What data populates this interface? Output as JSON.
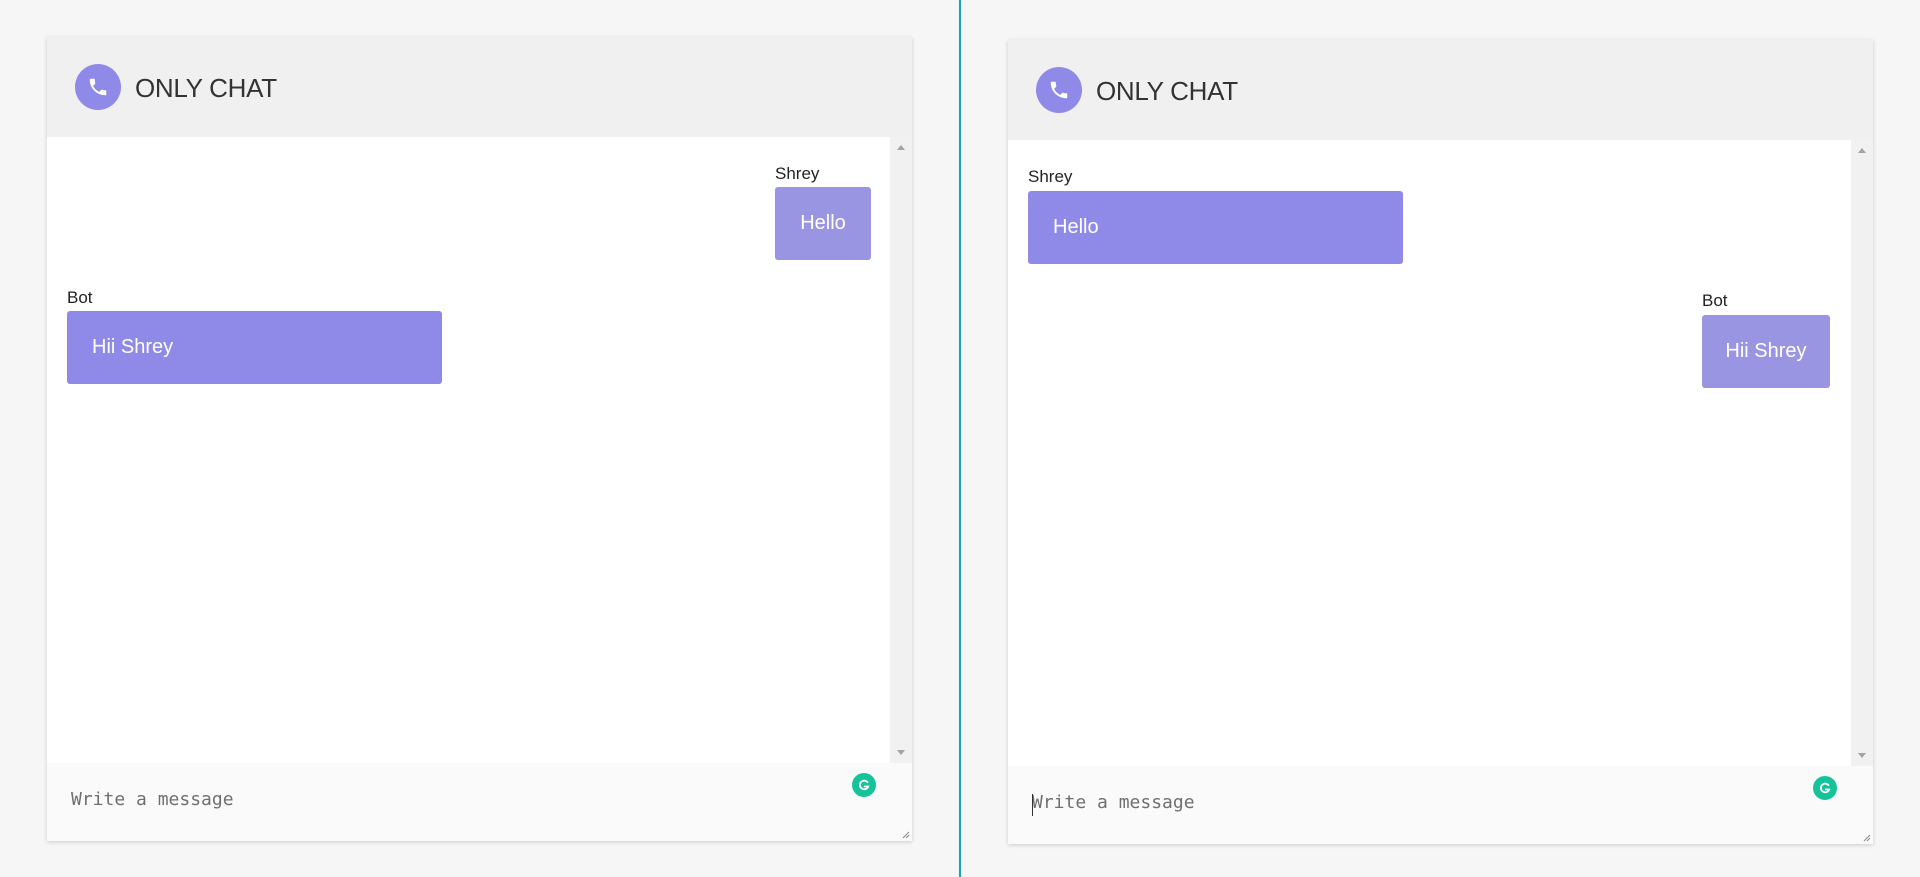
{
  "colors": {
    "accent": "#8f8ae7",
    "bubble_self": "#8f8ae8",
    "bubble_other": "#9a95e2",
    "header_bg": "#f0f0f0",
    "divider": "#19a2b0",
    "grammarly": "#15c39a"
  },
  "icons": {
    "header": "phone-icon",
    "assistant": "grammarly-icon"
  },
  "left_chat": {
    "header": {
      "title": "ONLY CHAT"
    },
    "messages": [
      {
        "sender": "Shrey",
        "text": "Hello",
        "side": "right"
      },
      {
        "sender": "Bot",
        "text": "Hii Shrey",
        "side": "left"
      }
    ],
    "composer": {
      "placeholder": "Write a message",
      "value": ""
    }
  },
  "right_chat": {
    "header": {
      "title": "ONLY CHAT"
    },
    "messages": [
      {
        "sender": "Shrey",
        "text": "Hello",
        "side": "left"
      },
      {
        "sender": "Bot",
        "text": "Hii Shrey",
        "side": "right"
      }
    ],
    "composer": {
      "placeholder": "Write a message",
      "value": ""
    }
  }
}
